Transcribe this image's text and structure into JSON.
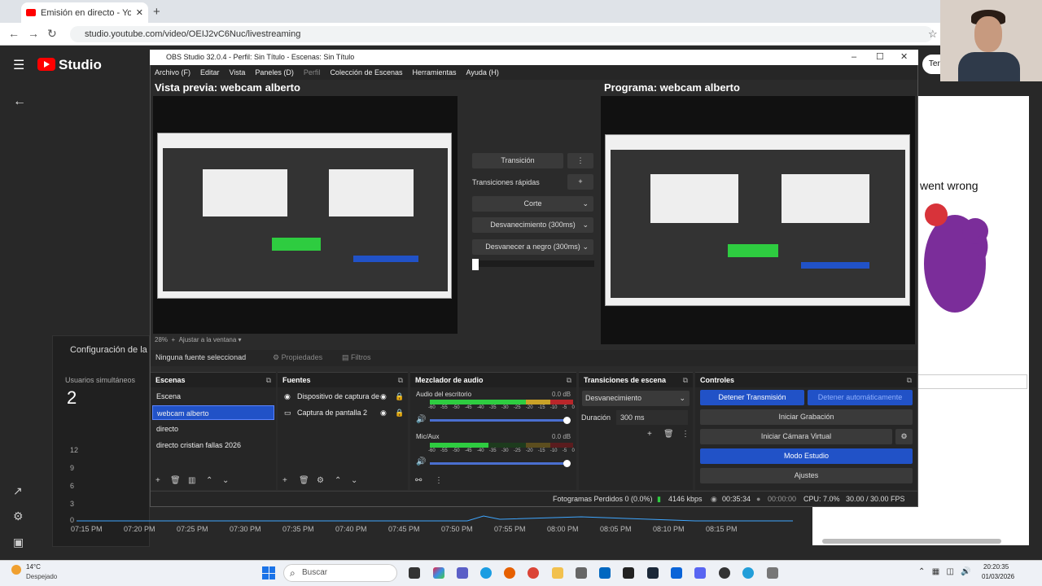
{
  "browser": {
    "tab_title": "Emisión en directo - YouTube S",
    "url": "studio.youtube.com/video/OEIJ2vC6Nuc/livestreaming"
  },
  "yt": {
    "studio_label": "Studio",
    "end_stream": "Terminar emisión",
    "config_title": "Configuración de la en",
    "users_label": "Usuarios simultáneos",
    "users_count": "2",
    "y_ticks": [
      "12",
      "9",
      "6",
      "3",
      "0"
    ],
    "x_ticks": [
      "07:15 PM",
      "07:20 PM",
      "07:25 PM",
      "07:30 PM",
      "07:35 PM",
      "07:40 PM",
      "07:45 PM",
      "07:50 PM",
      "07:55 PM",
      "08:00 PM",
      "08:05 PM",
      "08:10 PM",
      "08:15 PM"
    ],
    "error_text": "went wrong"
  },
  "obs": {
    "title": "OBS Studio 32.0.4 - Perfil: Sin Título - Escenas: Sin Título",
    "menu": [
      "Archivo (F)",
      "Editar",
      "Vista",
      "Paneles (D)",
      "Perfil",
      "Colección de Escenas",
      "Herramientas",
      "Ayuda (H)"
    ],
    "preview_title": "Vista previa: webcam alberto",
    "program_title": "Programa: webcam alberto",
    "zoom": "28%",
    "fit": "Ajustar a la ventana",
    "transition_btn": "Transición",
    "quick_transitions": "Transiciones rápidas",
    "quick": [
      "Corte",
      "Desvanecimiento (300ms)",
      "Desvanecer a negro (300ms)"
    ],
    "no_source": "Ninguna fuente seleccionad",
    "properties": "Propiedades",
    "filters": "Filtros",
    "scenes_title": "Escenas",
    "scenes": [
      "Escena",
      "webcam alberto",
      "directo",
      "directo cristian fallas 2026"
    ],
    "sources_title": "Fuentes",
    "sources": [
      "Dispositivo de captura de",
      "Captura de pantalla 2"
    ],
    "mixer_title": "Mezclador de audio",
    "mixer": [
      {
        "name": "Audio del escritorio",
        "db": "0.0 dB"
      },
      {
        "name": "Mic/Aux",
        "db": "0.0 dB"
      }
    ],
    "meter_scale": [
      "-60",
      "-55",
      "-50",
      "-45",
      "-40",
      "-35",
      "-30",
      "-25",
      "-20",
      "-15",
      "-10",
      "-5",
      "0"
    ],
    "transitions_title": "Transiciones de escena",
    "transition_select": "Desvanecimiento",
    "duration_label": "Duración",
    "duration_value": "300 ms",
    "controls_title": "Controles",
    "controls": {
      "stop_stream": "Detener Transmisión",
      "stop_auto": "Detener automáticamente",
      "record": "Iniciar Grabación",
      "virtual_cam": "Iniciar Cámara Virtual",
      "studio_mode": "Modo Estudio",
      "settings": "Ajustes"
    },
    "status": {
      "dropped": "Fotogramas Perdidos 0 (0.0%)",
      "bitrate": "4146 kbps",
      "stream_time": "00:35:34",
      "rec_time": "00:00:00",
      "cpu": "CPU: 7.0%",
      "fps": "30.00 / 30.00 FPS"
    }
  },
  "taskbar": {
    "temp": "14°C",
    "weather": "Despejado",
    "search": "Buscar",
    "time": "20:20:35",
    "date": "01/03/2026"
  },
  "colors": {
    "obs_blue": "#2152c7",
    "yt_red": "#ff0000",
    "meter_green": "#2ecc40",
    "meter_yellow": "#c9a227",
    "meter_red": "#b8262a"
  }
}
